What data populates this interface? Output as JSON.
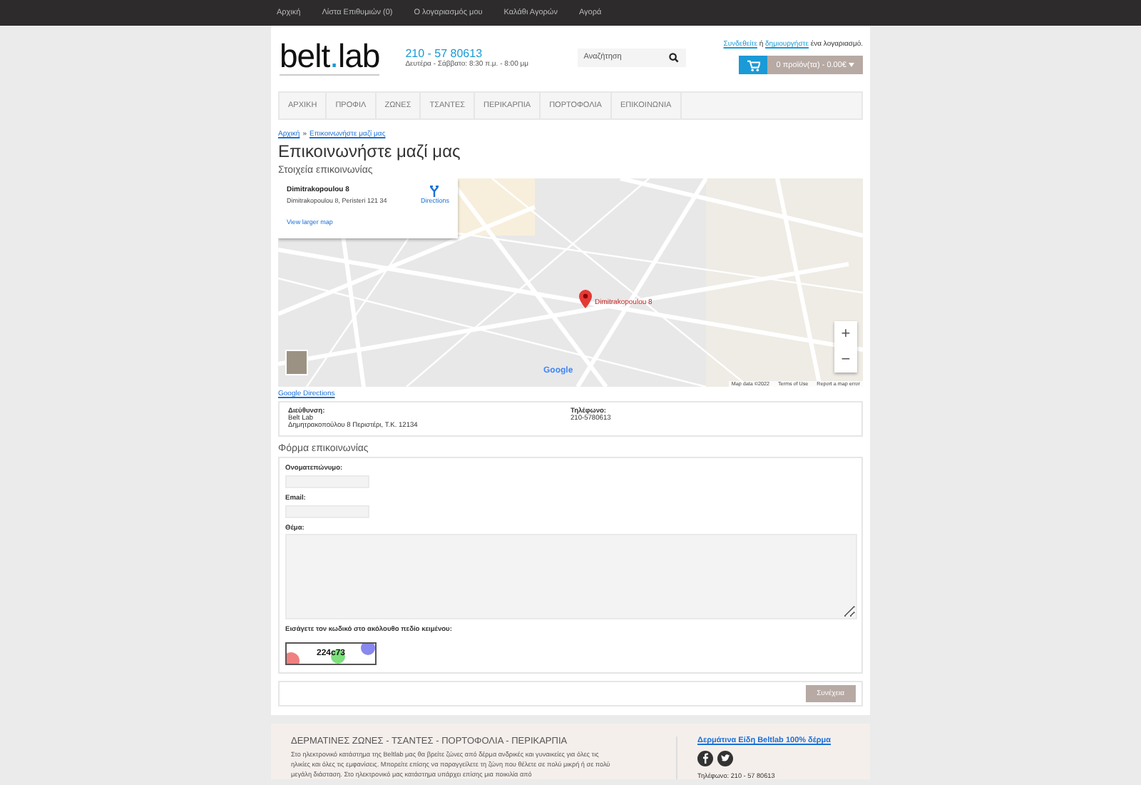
{
  "top_links": [
    "Αρχική",
    "Λίστα Επιθυμιών (0)",
    "Ο λογαριασμός μου",
    "Καλάθι Αγορών",
    "Αγορά"
  ],
  "header": {
    "logo": {
      "left": "belt",
      "dot": ".",
      "right": "lab"
    },
    "phone": "210 - 57 80613",
    "hours": "Δευτέρα - Σάββατο: 8:30 π.μ. - 8:00 μμ",
    "search": {
      "placeholder": "Αναζήτηση"
    },
    "login_link": "Συνδεθείτε",
    "login_or": "ή",
    "register_link": "δημιουργήστε",
    "login_tail": "ένα λογαριασμό.",
    "cart": "0 προϊόν(τα) - 0.00€"
  },
  "nav": [
    "ΑΡΧΙΚΗ",
    "ΠΡΟΦΙΛ",
    "ΖΩΝΕΣ",
    "ΤΣΑΝΤΕΣ",
    "ΠΕΡΙΚΑΡΠΙΑ",
    "ΠΟΡΤΟΦΟΛΙΑ",
    "ΕΠΙΚΟΙΝΩΝΙΑ"
  ],
  "breadcrumb": [
    "Αρχική",
    "Επικοινωνήστε μαζί μας"
  ],
  "breadcrumb_separator": "»",
  "title": "Επικοινωνήστε μαζί μας",
  "contact_heading": "Στοιχεία επικοινωνίας",
  "map": {
    "place": "Dimitrakopoulou 8",
    "address": "Dimitrakopoulou 8, Peristeri 121 34",
    "directions": "Directions",
    "larger": "View larger map",
    "marker_label": "Dimitrakopoulou 8",
    "zoom_in": "+",
    "zoom_out": "−",
    "google": "Google",
    "footer": [
      "Map data ©2022",
      "Terms of Use",
      "Report a map error"
    ]
  },
  "google_directions": "Google Directions",
  "address": {
    "label": "Διεύθυνση:",
    "name": "Belt Lab",
    "street": "Δημητρακοπούλου 8 Περιστέρι, Τ.Κ. 12134",
    "phone_label": "Τηλέφωνο:",
    "phone": "210-5780613"
  },
  "form": {
    "heading": "Φόρμα επικοινωνίας",
    "fields": [
      {
        "label": "Ονοματεπώνυμο:",
        "kind": "input"
      },
      {
        "label": "Email:",
        "kind": "input"
      },
      {
        "label": "Θέμα:",
        "kind": "textarea"
      }
    ],
    "captcha_label": "Εισάγετε τον κωδικό στο ακόλουθο πεδίο κειμένου:",
    "captcha": "224c73",
    "submit": "Συνέχεια"
  },
  "footer": {
    "heading": "ΔΕΡΜΑΤΙΝΕΣ ΖΩΝΕΣ - ΤΣΑΝΤΕΣ - ΠΟΡΤΟΦΟΛΙΑ - ΠΕΡΙΚΑΡΠΙΑ",
    "text": "Στο ηλεκτρονικό κατάστημα της Beltlab μας θα βρείτε ζώνες από δέρμα ανδρικές και γυναικείες για όλες τις ηλικίες και όλες τις εμφανίσεις. Μπορείτε επίσης να παραγγείλετε τη ζώνη που θέλετε σε πολύ μικρή ή σε πολύ μεγάλη διάσταση. Στο ηλεκτρονικό μας κατάστημα υπάρχει επίσης μια ποικιλία από",
    "link": "Δερμάτινα Είδη Beltlab 100% δέρμα",
    "phone": "Τηλέφωνο: 210 - 57 80613"
  }
}
